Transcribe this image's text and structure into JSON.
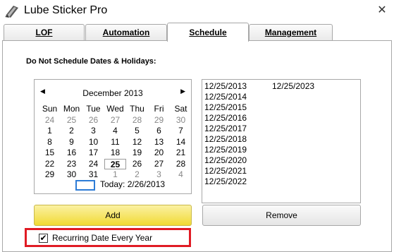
{
  "window": {
    "title": "Lube Sticker Pro",
    "close_glyph": "✕"
  },
  "tabs": [
    {
      "label": "LOF",
      "active": false
    },
    {
      "label": "Automation",
      "active": false
    },
    {
      "label": "Schedule",
      "active": true
    },
    {
      "label": "Management",
      "active": false
    }
  ],
  "schedule": {
    "heading": "Do Not Schedule Dates & Holidays:",
    "calendar": {
      "prev_glyph": "◀",
      "next_glyph": "▶",
      "month_label": "December 2013",
      "weekdays": [
        "Sun",
        "Mon",
        "Tue",
        "Wed",
        "Thu",
        "Fri",
        "Sat"
      ],
      "weeks": [
        [
          {
            "d": "24",
            "other": true
          },
          {
            "d": "25",
            "other": true
          },
          {
            "d": "26",
            "other": true
          },
          {
            "d": "27",
            "other": true
          },
          {
            "d": "28",
            "other": true
          },
          {
            "d": "29",
            "other": true
          },
          {
            "d": "30",
            "other": true
          }
        ],
        [
          {
            "d": "1"
          },
          {
            "d": "2"
          },
          {
            "d": "3"
          },
          {
            "d": "4"
          },
          {
            "d": "5"
          },
          {
            "d": "6"
          },
          {
            "d": "7"
          }
        ],
        [
          {
            "d": "8"
          },
          {
            "d": "9"
          },
          {
            "d": "10"
          },
          {
            "d": "11"
          },
          {
            "d": "12"
          },
          {
            "d": "13"
          },
          {
            "d": "14"
          }
        ],
        [
          {
            "d": "15"
          },
          {
            "d": "16"
          },
          {
            "d": "17"
          },
          {
            "d": "18"
          },
          {
            "d": "19"
          },
          {
            "d": "20"
          },
          {
            "d": "21"
          }
        ],
        [
          {
            "d": "22"
          },
          {
            "d": "23"
          },
          {
            "d": "24"
          },
          {
            "d": "25",
            "selected": true
          },
          {
            "d": "26"
          },
          {
            "d": "27"
          },
          {
            "d": "28"
          }
        ],
        [
          {
            "d": "29"
          },
          {
            "d": "30"
          },
          {
            "d": "31"
          },
          {
            "d": "1",
            "other": true
          },
          {
            "d": "2",
            "other": true
          },
          {
            "d": "3",
            "other": true
          },
          {
            "d": "4",
            "other": true
          }
        ]
      ],
      "today_label": "Today: 2/26/2013"
    },
    "date_list_col1": [
      "12/25/2013",
      "12/25/2014",
      "12/25/2015",
      "12/25/2016",
      "12/25/2017",
      "12/25/2018",
      "12/25/2019",
      "12/25/2020",
      "12/25/2021",
      "12/25/2022"
    ],
    "date_list_col2": [
      "12/25/2023"
    ],
    "add_label": "Add",
    "remove_label": "Remove",
    "recurring": {
      "label": "Recurring Date Every Year",
      "checked": true,
      "check_glyph": "✔"
    }
  },
  "colors": {
    "add_button": "#f1da34",
    "highlight_border": "#e01b24",
    "today_box": "#2d7cd6"
  }
}
